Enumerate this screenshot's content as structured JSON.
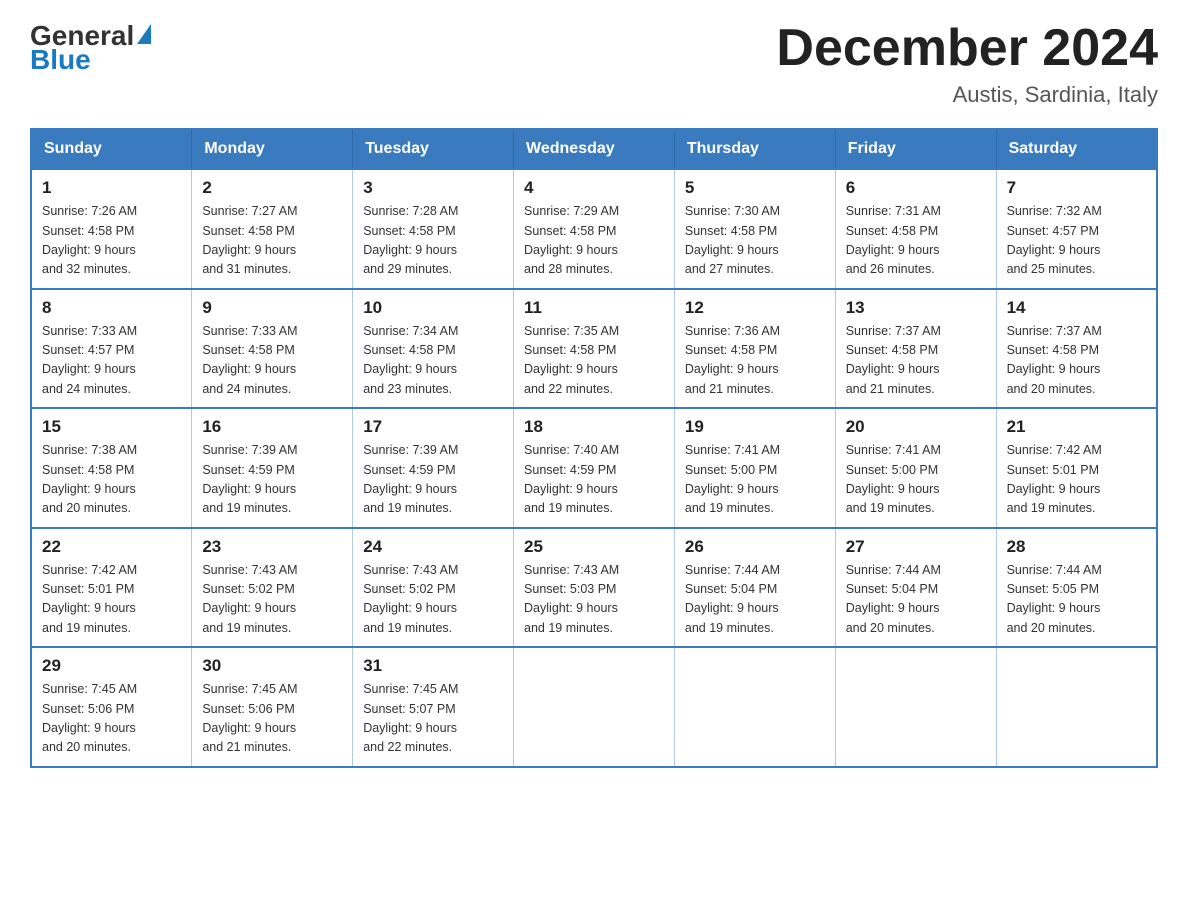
{
  "header": {
    "logo_general": "General",
    "logo_blue": "Blue",
    "main_title": "December 2024",
    "subtitle": "Austis, Sardinia, Italy"
  },
  "days_of_week": [
    "Sunday",
    "Monday",
    "Tuesday",
    "Wednesday",
    "Thursday",
    "Friday",
    "Saturday"
  ],
  "weeks": [
    [
      {
        "day": "1",
        "sunrise": "7:26 AM",
        "sunset": "4:58 PM",
        "daylight": "9 hours and 32 minutes."
      },
      {
        "day": "2",
        "sunrise": "7:27 AM",
        "sunset": "4:58 PM",
        "daylight": "9 hours and 31 minutes."
      },
      {
        "day": "3",
        "sunrise": "7:28 AM",
        "sunset": "4:58 PM",
        "daylight": "9 hours and 29 minutes."
      },
      {
        "day": "4",
        "sunrise": "7:29 AM",
        "sunset": "4:58 PM",
        "daylight": "9 hours and 28 minutes."
      },
      {
        "day": "5",
        "sunrise": "7:30 AM",
        "sunset": "4:58 PM",
        "daylight": "9 hours and 27 minutes."
      },
      {
        "day": "6",
        "sunrise": "7:31 AM",
        "sunset": "4:58 PM",
        "daylight": "9 hours and 26 minutes."
      },
      {
        "day": "7",
        "sunrise": "7:32 AM",
        "sunset": "4:57 PM",
        "daylight": "9 hours and 25 minutes."
      }
    ],
    [
      {
        "day": "8",
        "sunrise": "7:33 AM",
        "sunset": "4:57 PM",
        "daylight": "9 hours and 24 minutes."
      },
      {
        "day": "9",
        "sunrise": "7:33 AM",
        "sunset": "4:58 PM",
        "daylight": "9 hours and 24 minutes."
      },
      {
        "day": "10",
        "sunrise": "7:34 AM",
        "sunset": "4:58 PM",
        "daylight": "9 hours and 23 minutes."
      },
      {
        "day": "11",
        "sunrise": "7:35 AM",
        "sunset": "4:58 PM",
        "daylight": "9 hours and 22 minutes."
      },
      {
        "day": "12",
        "sunrise": "7:36 AM",
        "sunset": "4:58 PM",
        "daylight": "9 hours and 21 minutes."
      },
      {
        "day": "13",
        "sunrise": "7:37 AM",
        "sunset": "4:58 PM",
        "daylight": "9 hours and 21 minutes."
      },
      {
        "day": "14",
        "sunrise": "7:37 AM",
        "sunset": "4:58 PM",
        "daylight": "9 hours and 20 minutes."
      }
    ],
    [
      {
        "day": "15",
        "sunrise": "7:38 AM",
        "sunset": "4:58 PM",
        "daylight": "9 hours and 20 minutes."
      },
      {
        "day": "16",
        "sunrise": "7:39 AM",
        "sunset": "4:59 PM",
        "daylight": "9 hours and 19 minutes."
      },
      {
        "day": "17",
        "sunrise": "7:39 AM",
        "sunset": "4:59 PM",
        "daylight": "9 hours and 19 minutes."
      },
      {
        "day": "18",
        "sunrise": "7:40 AM",
        "sunset": "4:59 PM",
        "daylight": "9 hours and 19 minutes."
      },
      {
        "day": "19",
        "sunrise": "7:41 AM",
        "sunset": "5:00 PM",
        "daylight": "9 hours and 19 minutes."
      },
      {
        "day": "20",
        "sunrise": "7:41 AM",
        "sunset": "5:00 PM",
        "daylight": "9 hours and 19 minutes."
      },
      {
        "day": "21",
        "sunrise": "7:42 AM",
        "sunset": "5:01 PM",
        "daylight": "9 hours and 19 minutes."
      }
    ],
    [
      {
        "day": "22",
        "sunrise": "7:42 AM",
        "sunset": "5:01 PM",
        "daylight": "9 hours and 19 minutes."
      },
      {
        "day": "23",
        "sunrise": "7:43 AM",
        "sunset": "5:02 PM",
        "daylight": "9 hours and 19 minutes."
      },
      {
        "day": "24",
        "sunrise": "7:43 AM",
        "sunset": "5:02 PM",
        "daylight": "9 hours and 19 minutes."
      },
      {
        "day": "25",
        "sunrise": "7:43 AM",
        "sunset": "5:03 PM",
        "daylight": "9 hours and 19 minutes."
      },
      {
        "day": "26",
        "sunrise": "7:44 AM",
        "sunset": "5:04 PM",
        "daylight": "9 hours and 19 minutes."
      },
      {
        "day": "27",
        "sunrise": "7:44 AM",
        "sunset": "5:04 PM",
        "daylight": "9 hours and 20 minutes."
      },
      {
        "day": "28",
        "sunrise": "7:44 AM",
        "sunset": "5:05 PM",
        "daylight": "9 hours and 20 minutes."
      }
    ],
    [
      {
        "day": "29",
        "sunrise": "7:45 AM",
        "sunset": "5:06 PM",
        "daylight": "9 hours and 20 minutes."
      },
      {
        "day": "30",
        "sunrise": "7:45 AM",
        "sunset": "5:06 PM",
        "daylight": "9 hours and 21 minutes."
      },
      {
        "day": "31",
        "sunrise": "7:45 AM",
        "sunset": "5:07 PM",
        "daylight": "9 hours and 22 minutes."
      },
      null,
      null,
      null,
      null
    ]
  ],
  "labels": {
    "sunrise": "Sunrise:",
    "sunset": "Sunset:",
    "daylight": "Daylight:"
  }
}
